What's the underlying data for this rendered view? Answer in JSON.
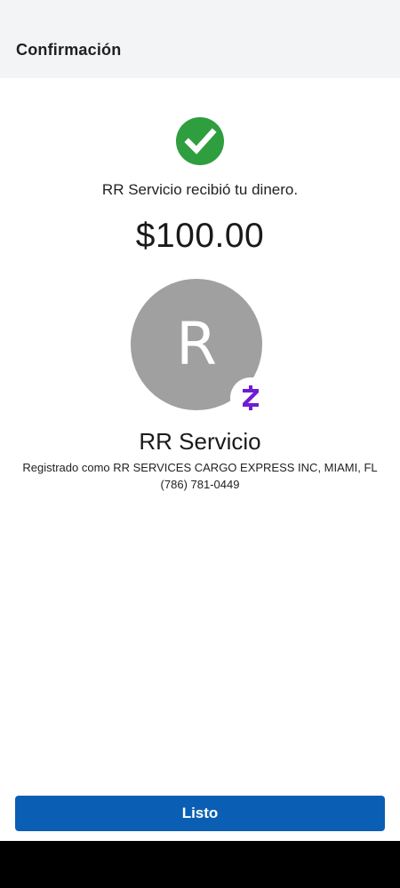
{
  "header": {
    "title": "Confirmación"
  },
  "status": {
    "icon": "check-circle-icon",
    "color": "#2e9e3f",
    "message": "RR Servicio recibió tu dinero."
  },
  "payment": {
    "amount": "$100.00"
  },
  "recipient": {
    "avatar_letter": "R",
    "avatar_color": "#a0a0a0",
    "badge_icon": "zelle-icon",
    "badge_color": "#6d1ed4",
    "name": "RR Servicio",
    "registered_as": "Registrado como RR SERVICES CARGO EXPRESS INC, MIAMI, FL",
    "phone": "(786) 781-0449"
  },
  "actions": {
    "done_label": "Listo",
    "done_color": "#0a5fb4"
  }
}
